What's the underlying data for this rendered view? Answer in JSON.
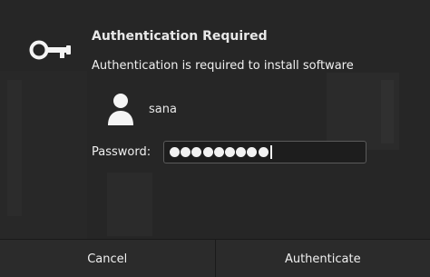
{
  "dialog": {
    "title": "Authentication Required",
    "message": "Authentication is required to install software",
    "icon": "key-icon"
  },
  "user": {
    "name": "sana",
    "icon": "user-avatar-icon"
  },
  "password": {
    "label": "Password:",
    "masked_length": 9,
    "mask_glyph": "●"
  },
  "buttons": {
    "cancel_label": "Cancel",
    "authenticate_label": "Authenticate"
  },
  "colors": {
    "background": "#262626",
    "text": "#f0f0f0",
    "field_border": "#5a5a5a"
  }
}
